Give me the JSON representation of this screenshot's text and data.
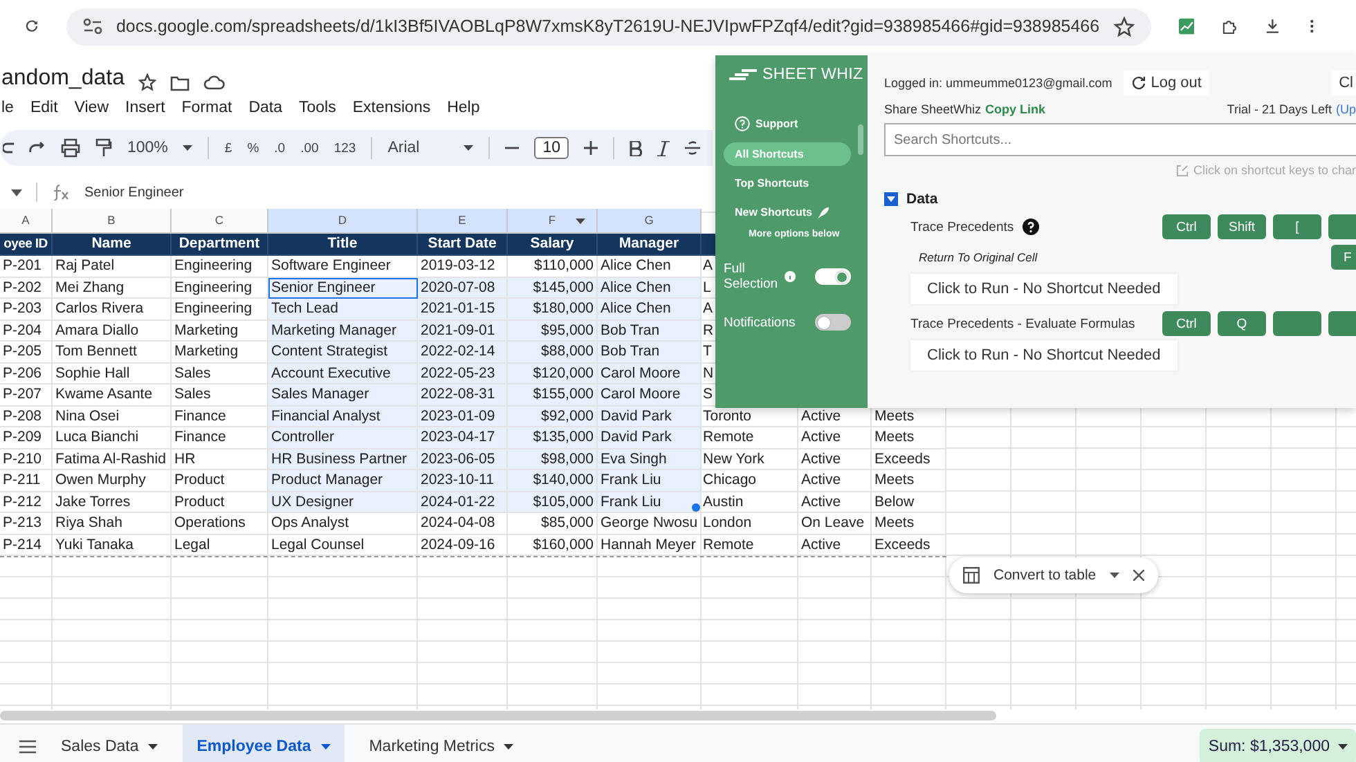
{
  "browser": {
    "url": "docs.google.com/spreadsheets/d/1kI3Bf5IVAOBLqP8W7xmsK8yT2619U-NEJVIpwFPZqf4/edit?gid=938985466#gid=938985466"
  },
  "document": {
    "title": "andom_data"
  },
  "menu": [
    "le",
    "Edit",
    "View",
    "Insert",
    "Format",
    "Data",
    "Tools",
    "Extensions",
    "Help"
  ],
  "toolbar": {
    "zoom": "100%",
    "currency": "£",
    "percent": "%",
    "decrease_decimals": ".0",
    "increase_decimals": ".00",
    "number_format": "123",
    "font": "Arial",
    "font_size": "10"
  },
  "formula_bar": {
    "value": "Senior Engineer"
  },
  "columns": [
    {
      "letter": "A",
      "selected": false
    },
    {
      "letter": "B",
      "selected": false
    },
    {
      "letter": "C",
      "selected": false
    },
    {
      "letter": "D",
      "selected": true
    },
    {
      "letter": "E",
      "selected": true
    },
    {
      "letter": "F",
      "selected": true,
      "filter": true
    },
    {
      "letter": "G",
      "selected": true
    }
  ],
  "table": {
    "headers": [
      "oyee ID",
      "Name",
      "Department",
      "Title",
      "Start Date",
      "Salary",
      "Manager"
    ],
    "rows": [
      {
        "cells": [
          "P-201",
          "Raj Patel",
          "Engineering",
          "Software Engineer",
          "2019-03-12",
          "$110,000",
          "Alice Chen",
          "A"
        ],
        "selected": false,
        "active": false
      },
      {
        "cells": [
          "P-202",
          "Mei Zhang",
          "Engineering",
          "Senior Engineer",
          "2020-07-08",
          "$145,000",
          "Alice Chen",
          "L"
        ],
        "selected": true,
        "active": true
      },
      {
        "cells": [
          "P-203",
          "Carlos Rivera",
          "Engineering",
          "Tech Lead",
          "2021-01-15",
          "$180,000",
          "Alice Chen",
          "A"
        ],
        "selected": true,
        "active": false
      },
      {
        "cells": [
          "P-204",
          "Amara Diallo",
          "Marketing",
          "Marketing Manager",
          "2021-09-01",
          "$95,000",
          "Bob Tran",
          "R"
        ],
        "selected": true,
        "active": false
      },
      {
        "cells": [
          "P-205",
          "Tom Bennett",
          "Marketing",
          "Content Strategist",
          "2022-02-14",
          "$88,000",
          "Bob Tran",
          "T"
        ],
        "selected": true,
        "active": false
      },
      {
        "cells": [
          "P-206",
          "Sophie Hall",
          "Sales",
          "Account Executive",
          "2022-05-23",
          "$120,000",
          "Carol Moore",
          "N"
        ],
        "selected": true,
        "active": false
      },
      {
        "cells": [
          "P-207",
          "Kwame Asante",
          "Sales",
          "Sales Manager",
          "2022-08-31",
          "$155,000",
          "Carol Moore",
          "S"
        ],
        "selected": true,
        "active": false
      },
      {
        "cells": [
          "P-208",
          "Nina Osei",
          "Finance",
          "Financial Analyst",
          "2023-01-09",
          "$92,000",
          "David Park",
          "Toronto",
          "Active",
          "Meets"
        ],
        "selected": true,
        "active": false
      },
      {
        "cells": [
          "P-209",
          "Luca Bianchi",
          "Finance",
          "Controller",
          "2023-04-17",
          "$135,000",
          "David Park",
          "Remote",
          "Active",
          "Meets"
        ],
        "selected": true,
        "active": false
      },
      {
        "cells": [
          "P-210",
          "Fatima Al-Rashid",
          "HR",
          "HR Business Partner",
          "2023-06-05",
          "$98,000",
          "Eva Singh",
          "New York",
          "Active",
          "Exceeds"
        ],
        "selected": true,
        "active": false
      },
      {
        "cells": [
          "P-211",
          "Owen Murphy",
          "Product",
          "Product Manager",
          "2023-10-11",
          "$140,000",
          "Frank Liu",
          "Chicago",
          "Active",
          "Meets"
        ],
        "selected": true,
        "active": false
      },
      {
        "cells": [
          "P-212",
          "Jake Torres",
          "Product",
          "UX Designer",
          "2024-01-22",
          "$105,000",
          "Frank Liu",
          "Austin",
          "Active",
          "Below"
        ],
        "selected": true,
        "active": false
      },
      {
        "cells": [
          "P-213",
          "Riya Shah",
          "Operations",
          "Ops Analyst",
          "2024-04-08",
          "$85,000",
          "George Nwosu",
          "London",
          "On Leave",
          "Meets"
        ],
        "selected": false,
        "active": false
      },
      {
        "cells": [
          "P-214",
          "Yuki Tanaka",
          "Legal",
          "Legal Counsel",
          "2024-09-16",
          "$160,000",
          "Hannah Meyer",
          "Remote",
          "Active",
          "Exceeds"
        ],
        "selected": false,
        "active": false
      }
    ]
  },
  "convert_popup": {
    "label": "Convert to table"
  },
  "sheet_tabs": [
    {
      "label": "Sales Data",
      "selected": false
    },
    {
      "label": "Employee Data",
      "selected": true
    },
    {
      "label": "Marketing Metrics",
      "selected": false
    }
  ],
  "sum": "Sum: $1,353,000",
  "extension": {
    "logo": "SHEET WHIZ",
    "nav": [
      {
        "label": "Support",
        "kind": "help",
        "selected": false
      },
      {
        "label": "All Shortcuts",
        "kind": "plain",
        "selected": true
      },
      {
        "label": "Top Shortcuts",
        "kind": "plain",
        "selected": false
      },
      {
        "label": "New Shortcuts",
        "kind": "rocket",
        "selected": false
      }
    ],
    "more_options": "More options below",
    "toggles": [
      {
        "label": "Full Selection",
        "info": true,
        "on": true
      },
      {
        "label": "Notifications",
        "on": false
      }
    ],
    "logged_in": "Logged in: ummeumme0123@gmail.com",
    "logout": "Log out",
    "close_cut": "Cl",
    "share_label": "Share SheetWhiz",
    "share_link": "Copy Link",
    "trial": "Trial - 21 Days Left",
    "upgrade_cut": "(Up",
    "search_placeholder": "Search Shortcuts...",
    "hint": "Click on shortcut keys to char",
    "section": {
      "title": "Data",
      "expanded": true
    },
    "shortcuts": [
      {
        "name": "Trace Precedents",
        "help": true,
        "keys": [
          {
            "kind": "label",
            "label": "Ctrl"
          },
          {
            "kind": "label",
            "label": "Shift"
          },
          {
            "kind": "label",
            "label": "["
          },
          {
            "kind": "blank"
          }
        ],
        "sub_label": "Return To Original Cell",
        "sub_keys": [
          {
            "kind": "label",
            "label": "F"
          }
        ],
        "run": "Click to Run - No Shortcut Needed"
      },
      {
        "name": "Trace Precedents - Evaluate Formulas",
        "keys": [
          {
            "kind": "label",
            "label": "Ctrl"
          },
          {
            "kind": "label",
            "label": "Q"
          },
          {
            "kind": "blank"
          },
          {
            "kind": "blank"
          }
        ],
        "run": "Click to Run - No Shortcut Needed"
      }
    ]
  }
}
